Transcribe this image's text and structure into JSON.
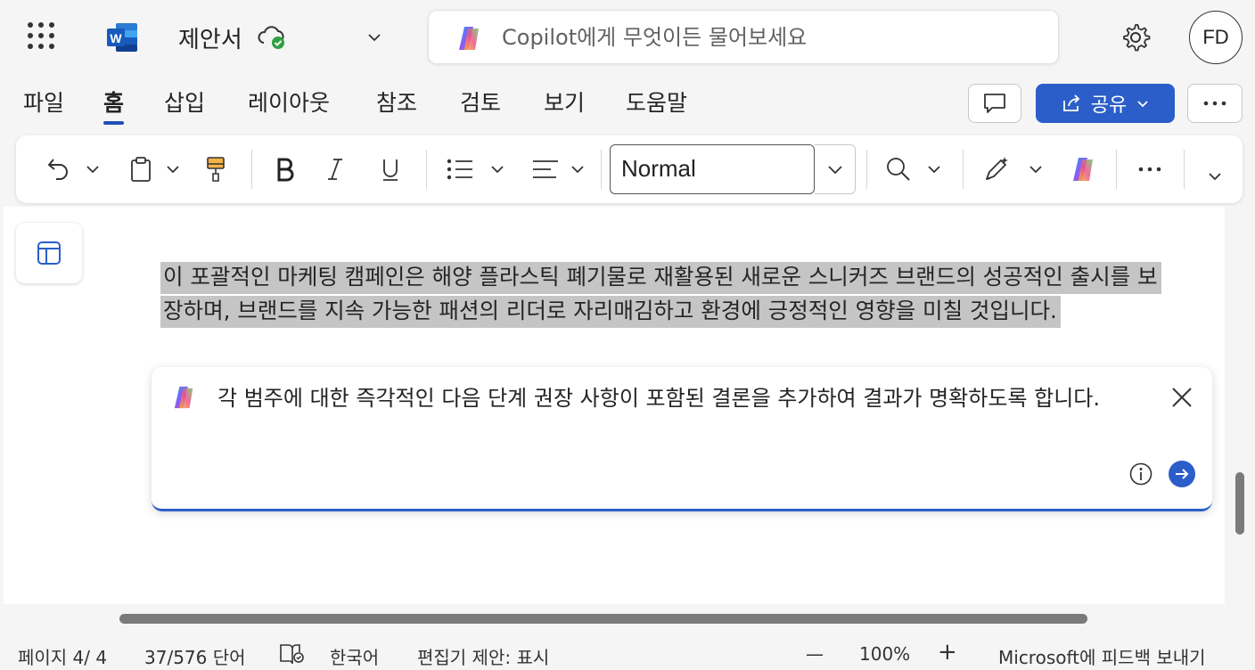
{
  "app": {
    "document_title": "제안서",
    "copilot_placeholder": "Copilot에게 무엇이든 물어보세요",
    "user_initials": "FD"
  },
  "menu": {
    "tabs": [
      {
        "label": "파일",
        "active": false
      },
      {
        "label": "홈",
        "active": true
      },
      {
        "label": "삽입",
        "active": false
      },
      {
        "label": "레이아웃",
        "active": false
      },
      {
        "label": "참조",
        "active": false
      },
      {
        "label": "검토",
        "active": false
      },
      {
        "label": "보기",
        "active": false
      },
      {
        "label": "도움말",
        "active": false
      }
    ],
    "share_label": "공유"
  },
  "ribbon": {
    "style_value": "Normal",
    "icons": [
      "undo-icon",
      "clipboard-icon",
      "format-painter-icon",
      "bold-icon",
      "italic-icon",
      "underline-icon",
      "bullets-icon",
      "align-icon",
      "find-icon",
      "editor-icon",
      "copilot-icon",
      "more-icon",
      "collapse-icon"
    ]
  },
  "document": {
    "selected_paragraph": "이 포괄적인 마케팅 캠페인은 해양 플라스틱 폐기물로 재활용된 새로운 스니커즈 브랜드의 성공적인 출시를 보장하며, 브랜드를 지속 가능한 패션의 리더로 자리매김하고 환경에 긍정적인 영향을 미칠 것입니다."
  },
  "copilot_prompt": {
    "text": "각 범주에 대한 즉각적인 다음 단계 권장 사항이 포함된 결론을 추가하여 결과가 명확하도록 합니다."
  },
  "statusbar": {
    "page": "페이지 4/ 4",
    "words": "37/576 단어",
    "language": "한국어",
    "editor_suggestions": "편집기 제안: 표시",
    "zoom_out": "—",
    "zoom": "100%",
    "zoom_in": "+",
    "feedback": "Microsoft에 피드백 보내기"
  },
  "colors": {
    "accent": "#2b5ec9",
    "selection": "#c5c5c5",
    "word_blue": "#185abd"
  }
}
